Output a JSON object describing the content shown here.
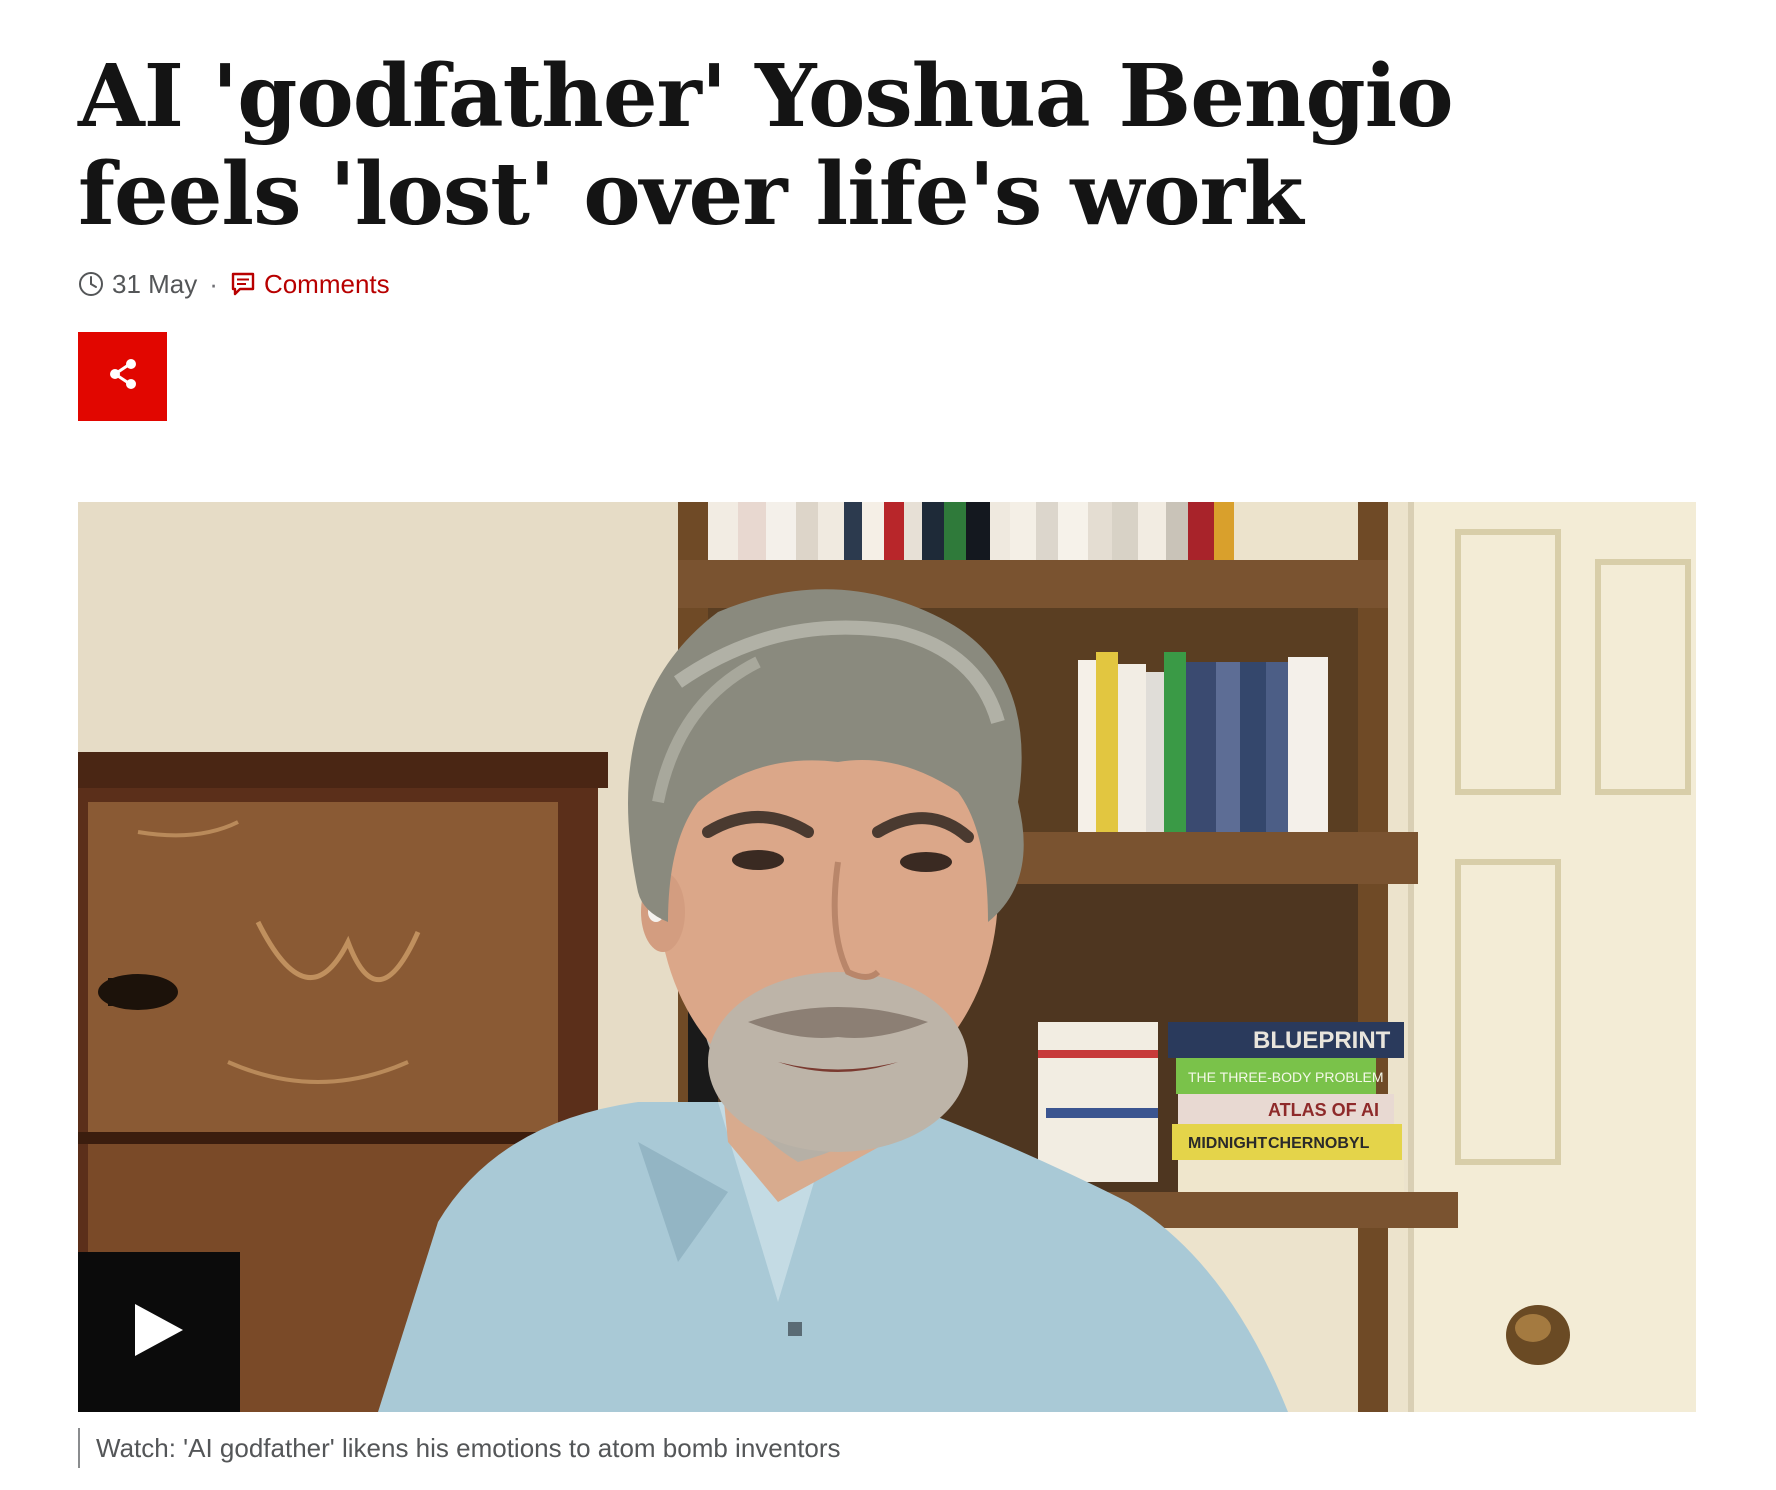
{
  "article": {
    "headline": "AI 'godfather' Yoshua Bengio feels 'lost' over life's work",
    "date": "31 May",
    "separator": "·",
    "comments_label": "Comments",
    "share_icon": "share-icon",
    "clock_icon": "clock-icon",
    "comments_icon": "comment-icon"
  },
  "media": {
    "play_icon": "play-icon",
    "caption": "Watch: 'AI godfather' likens his emotions to atom bomb inventors",
    "book_titles": [
      "BLUEPRINT",
      "THE THREE-BODY PROBLEM",
      "ATLAS OF AI",
      "MIDNIGHT",
      "CHERNOBYL"
    ]
  },
  "colors": {
    "accent": "#b80000",
    "share_bg": "#e10600",
    "text": "#141414",
    "meta": "#545658"
  }
}
